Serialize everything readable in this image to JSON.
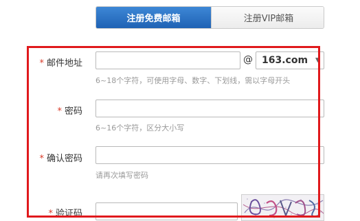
{
  "tabs": {
    "free": "注册免费邮箱",
    "vip": "注册VIP邮箱"
  },
  "form": {
    "required_mark": "*",
    "email": {
      "label": "邮件地址",
      "value": "",
      "at": "@",
      "domain": "163.com",
      "hint": "6~18个字符，可使用字母、数字、下划线，需以字母开头"
    },
    "password": {
      "label": "密码",
      "value": "",
      "hint": "6~16个字符，区分大小写"
    },
    "confirm": {
      "label": "确认密码",
      "value": "",
      "hint": "请再次填写密码"
    },
    "captcha": {
      "label": "验证码",
      "value": ""
    }
  },
  "colors": {
    "accent": "#1f62b4",
    "required": "#d93a28",
    "highlight": "#e0191c",
    "hint": "#999999"
  }
}
